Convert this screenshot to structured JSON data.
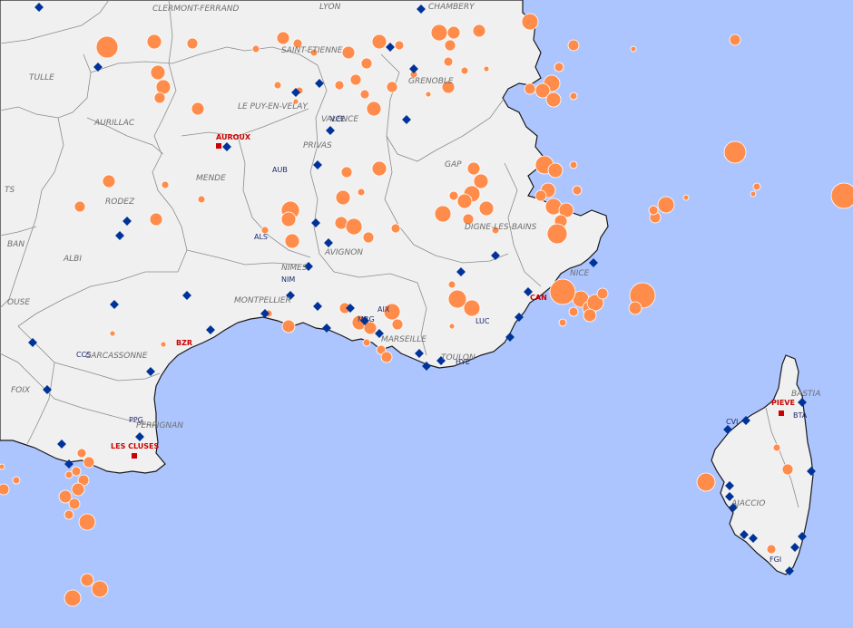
{
  "colors": {
    "sea": "#adc5ff",
    "land": "#f0f0f0",
    "coast": "#1a1a1a",
    "border": "#8c8c8c",
    "quake": "#ff8c4a",
    "quake_outline": "#ffffff",
    "station_blue": "#003399",
    "station_red": "#cc0000",
    "city_label": "#6e6e6e"
  },
  "city_labels": [
    {
      "name": "CLERMONT-FERRAND"
    },
    {
      "name": "LYON"
    },
    {
      "name": "CHAMBERY"
    },
    {
      "name": "SAINT-ETIENNE"
    },
    {
      "name": "TULLE"
    },
    {
      "name": "LE PUY-EN-VELAY"
    },
    {
      "name": "GRENOBLE"
    },
    {
      "name": "AURILLAC"
    },
    {
      "name": "VALENCE"
    },
    {
      "name": "PRIVAS"
    },
    {
      "name": "GAP"
    },
    {
      "name": "MENDE"
    },
    {
      "name": "RODEZ"
    },
    {
      "name": "DIGNE-LES-BAINS"
    },
    {
      "name": "AVIGNON"
    },
    {
      "name": "ALBI"
    },
    {
      "name": "NIMES"
    },
    {
      "name": "MONTPELLIER"
    },
    {
      "name": "NICE"
    },
    {
      "name": "CARCASSONNE"
    },
    {
      "name": "MARSEILLE"
    },
    {
      "name": "TOULON"
    },
    {
      "name": "FOIX"
    },
    {
      "name": "PERPIGNAN"
    },
    {
      "name": "BASTIA"
    },
    {
      "name": "AJACCIO"
    },
    {
      "name": "OUSE"
    },
    {
      "name": "BAN"
    },
    {
      "name": "TS"
    }
  ],
  "station_labels": [
    {
      "code": "AUROUX",
      "type": "red"
    },
    {
      "code": "VCE",
      "type": "blue"
    },
    {
      "code": "AUB",
      "type": "blue"
    },
    {
      "code": "ALS",
      "type": "blue"
    },
    {
      "code": "NIM",
      "type": "blue"
    },
    {
      "code": "MRG",
      "type": "blue"
    },
    {
      "code": "AIX",
      "type": "blue"
    },
    {
      "code": "LUC",
      "type": "blue"
    },
    {
      "code": "HYE",
      "type": "blue"
    },
    {
      "code": "CAN",
      "type": "red"
    },
    {
      "code": "BZR",
      "type": "red"
    },
    {
      "code": "CCS",
      "type": "blue"
    },
    {
      "code": "PPG",
      "type": "blue"
    },
    {
      "code": "LES CLUSES",
      "type": "red"
    },
    {
      "code": "PIEVE",
      "type": "red"
    },
    {
      "code": "BTA",
      "type": "blue"
    },
    {
      "code": "CVI",
      "type": "blue"
    },
    {
      "code": "FGI",
      "type": "blue"
    }
  ]
}
